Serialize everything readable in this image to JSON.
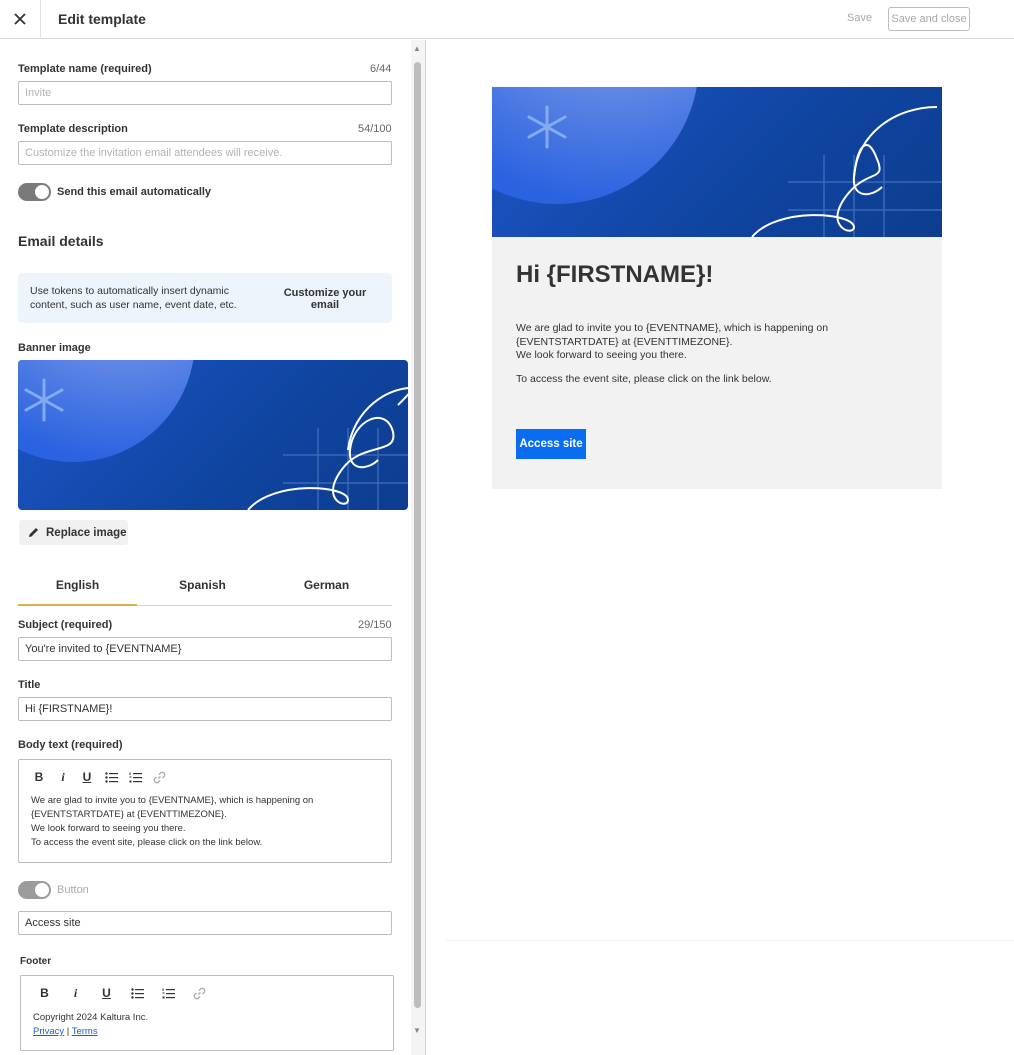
{
  "header": {
    "title": "Edit template",
    "save_label": "Save",
    "save_close_label": "Save and close"
  },
  "form": {
    "template_name": {
      "label": "Template name (required)",
      "counter": "6/44",
      "placeholder": "Invite"
    },
    "template_description": {
      "label": "Template description",
      "counter": "54/100",
      "placeholder": "Customize the invitation email attendees will receive."
    },
    "auto_send_label": "Send this email automatically",
    "email_details_heading": "Email details",
    "info_text": "Use tokens to automatically insert dynamic content, such as user name, event date, etc.",
    "customize_link": "Customize your email",
    "banner_label": "Banner image",
    "replace_image_label": "Replace image",
    "tabs": [
      {
        "label": "English",
        "active": true
      },
      {
        "label": "Spanish",
        "active": false
      },
      {
        "label": "German",
        "active": false
      }
    ],
    "subject": {
      "label": "Subject (required)",
      "counter": "29/150",
      "value": "You're invited to {EVENTNAME}"
    },
    "title": {
      "label": "Title",
      "value": "Hi {FIRSTNAME}!"
    },
    "body_text": {
      "label": "Body text (required)",
      "lines": [
        "We are glad to invite you to {EVENTNAME}, which is happening on",
        "{EVENTSTARTDATE} at {EVENTTIMEZONE}.",
        "We look forward to seeing you there.",
        "To access the event site, please click on the link below."
      ]
    },
    "button_toggle_label": "Button",
    "button_value": "Access site",
    "footer": {
      "label": "Footer",
      "copyright": "Copyright 2024 Kaltura Inc.",
      "privacy": "Privacy",
      "separator": "|",
      "terms": "Terms"
    }
  },
  "preview": {
    "title": "Hi {FIRSTNAME}!",
    "body_lines": [
      "We are glad to invite you to {EVENTNAME}, which is happening on {EVENTSTARTDATE} at {EVENTTIMEZONE}.",
      "We look forward to seeing you there."
    ],
    "body_line_2": "To access the event site, please click on the link below.",
    "button_label": "Access site"
  },
  "colors": {
    "accent_blue": "#0a6cf1",
    "tab_underline": "#e2b04a",
    "banner_blue": "#0f44a0",
    "info_bg": "#eef4fb"
  }
}
